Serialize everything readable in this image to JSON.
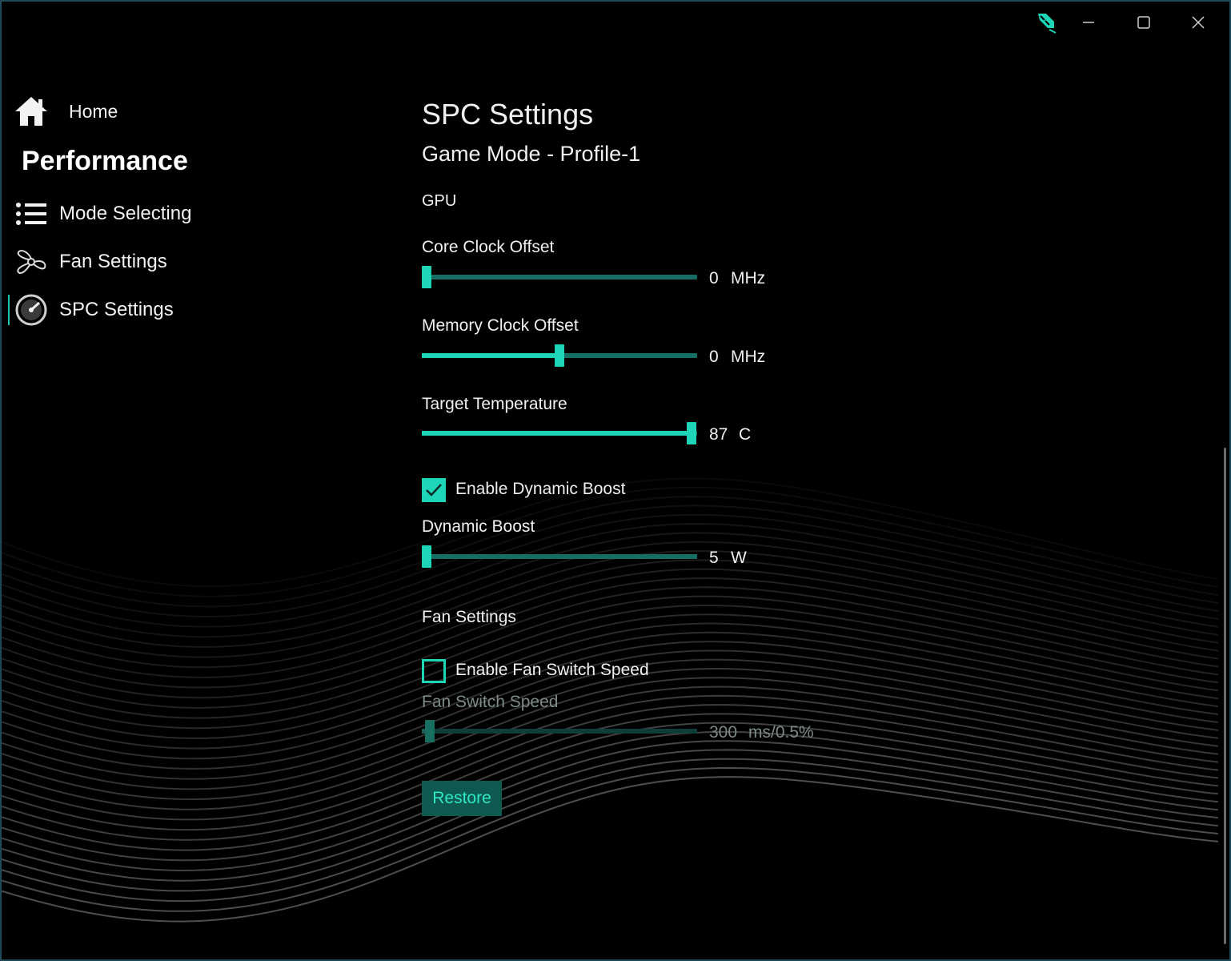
{
  "titlebar": {
    "app_icon": "pen-satellite-icon",
    "minimize_icon": "minimize-icon",
    "maximize_icon": "maximize-icon",
    "close_icon": "close-icon"
  },
  "sidebar": {
    "home": {
      "label": "Home",
      "icon": "home-icon"
    },
    "section_title": "Performance",
    "items": [
      {
        "label": "Mode Selecting",
        "icon": "list-icon"
      },
      {
        "label": "Fan Settings",
        "icon": "fan-icon"
      },
      {
        "label": "SPC Settings",
        "icon": "gauge-icon",
        "active": true
      }
    ]
  },
  "main": {
    "title": "SPC Settings",
    "subtitle": "Game Mode - Profile-1",
    "gpu_group": "GPU",
    "core_clock": {
      "label": "Core Clock Offset",
      "value": "0",
      "unit": "MHz",
      "level": 0.0
    },
    "memory_clock": {
      "label": "Memory Clock Offset",
      "value": "0",
      "unit": "MHz",
      "level": 0.5
    },
    "target_temp": {
      "label": "Target Temperature",
      "value": "87",
      "unit": "C",
      "level": 0.98
    },
    "dynamic_boost_toggle": {
      "label": "Enable Dynamic Boost",
      "checked": true
    },
    "dynamic_boost": {
      "label": "Dynamic Boost",
      "value": "5",
      "unit": "W",
      "level": 0.0
    },
    "fan_group": "Fan Settings",
    "fan_switch_toggle": {
      "label": "Enable Fan Switch Speed",
      "checked": false
    },
    "fan_switch_speed": {
      "label": "Fan Switch Speed",
      "value": "300",
      "unit": "ms/0.5%",
      "level": 0.03
    },
    "restore_label": "Restore"
  },
  "colors": {
    "accent": "#1ed6b7",
    "track": "#156e64",
    "background": "#000000",
    "window_border": "#1e4a58"
  }
}
